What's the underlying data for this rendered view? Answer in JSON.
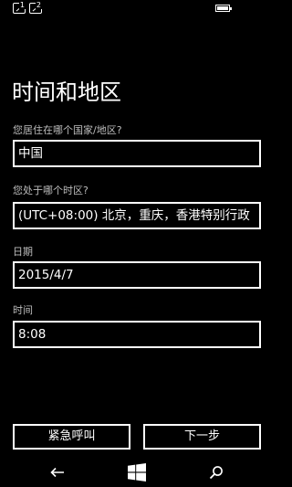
{
  "page": {
    "title": "时间和地区"
  },
  "fields": {
    "country": {
      "label": "您居住在哪个国家/地区?",
      "value": "中国"
    },
    "timezone": {
      "label": "您处于哪个时区?",
      "value": "(UTC+08:00) 北京，重庆，香港特别行政"
    },
    "date": {
      "label": "日期",
      "value": "2015/4/7"
    },
    "time": {
      "label": "时间",
      "value": "8:08"
    }
  },
  "buttons": {
    "emergency_call": "紧急呼叫",
    "next": "下一步"
  },
  "status_bar": {
    "sim1_number": "1",
    "sim2_number": "2"
  },
  "colors": {
    "background": "#000000",
    "foreground": "#ffffff",
    "label": "#bdbdbd"
  },
  "nav_icons": [
    "back-arrow-icon",
    "windows-logo-icon",
    "search-icon"
  ]
}
